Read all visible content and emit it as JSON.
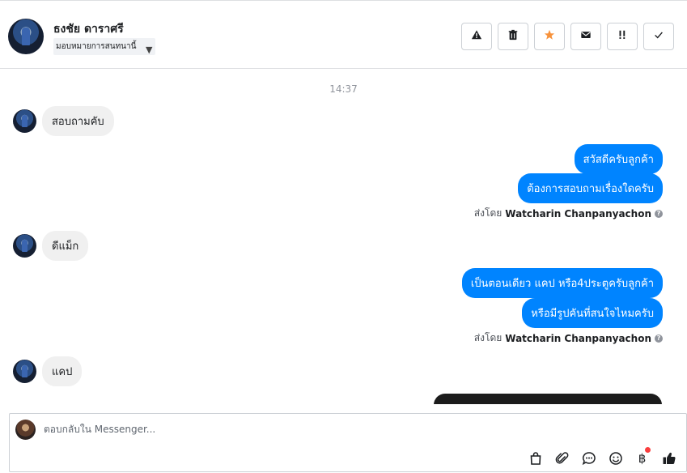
{
  "header": {
    "contact_name": "ธงชัย ดาราศรี",
    "assign_label": "มอบหมายการสนทนานี้",
    "actions": [
      {
        "icon": "warning-icon"
      },
      {
        "icon": "trash-icon"
      },
      {
        "icon": "star-icon",
        "color": "#f7923b"
      },
      {
        "icon": "envelope-icon"
      },
      {
        "icon": "follow-up-icon"
      },
      {
        "icon": "check-icon"
      }
    ]
  },
  "thread": {
    "timestamp": "14:37",
    "messages": [
      {
        "direction": "in",
        "text": "สอบถามคับ"
      },
      {
        "direction": "out",
        "text": "สวัสดีครับลูกค้า"
      },
      {
        "direction": "out",
        "text": "ต้องการสอบถามเรื่องใดครับ"
      },
      {
        "direction": "in",
        "text": "ดีแม็ก"
      },
      {
        "direction": "out",
        "text": "เป็นตอนเดียว แคป หรือ4ประตูครับลูกค้า"
      },
      {
        "direction": "out",
        "text": "หรือมีรูปคันที่สนใจไหมครับ"
      },
      {
        "direction": "in",
        "text": "แคป"
      }
    ],
    "sent_by_prefix": "ส่งโดย",
    "sent_by_name": "Watcharin Chanpanyachon"
  },
  "composer": {
    "placeholder": "ตอบกลับใน Messenger...",
    "tools": [
      "shopping-bag-icon",
      "paperclip-icon",
      "chat-bubble-icon",
      "emoji-icon",
      "baht-icon",
      "thumbs-up-icon"
    ]
  },
  "colors": {
    "outgoing_bubble": "#0084ff",
    "incoming_bubble": "#f0f0f0",
    "star": "#f7923b",
    "notification_dot": "#fa3e3e"
  }
}
